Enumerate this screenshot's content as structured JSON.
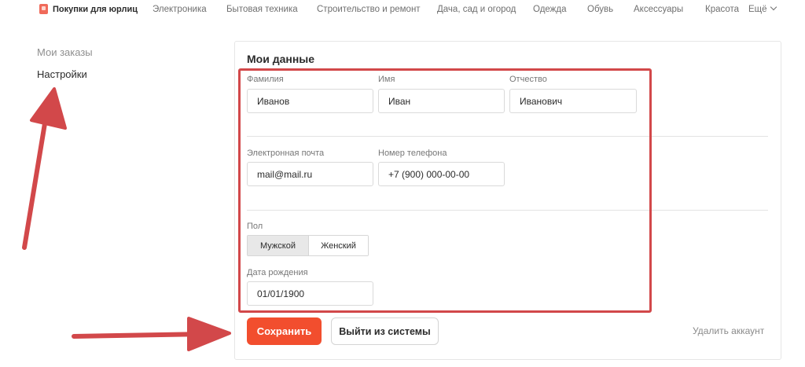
{
  "topnav": {
    "brand": "Покупки для юрлиц",
    "links": [
      "Электроника",
      "Бытовая техника",
      "Строительство и ремонт",
      "Дача, сад и огород",
      "Одежда",
      "Обувь",
      "Аксессуары",
      "Красота"
    ],
    "more": "Ещё"
  },
  "sidebar": {
    "items": [
      {
        "label": "Мои заказы",
        "active": false
      },
      {
        "label": "Настройки",
        "active": true
      }
    ]
  },
  "profile": {
    "title": "Мои данные",
    "last_name": {
      "label": "Фамилия",
      "value": "Иванов"
    },
    "first_name": {
      "label": "Имя",
      "value": "Иван"
    },
    "middle_name": {
      "label": "Отчество",
      "value": "Иванович"
    },
    "email": {
      "label": "Электронная почта",
      "value": "mail@mail.ru"
    },
    "phone": {
      "label": "Номер телефона",
      "value": "+7 (900) 000-00-00"
    },
    "gender": {
      "label": "Пол",
      "options": [
        "Мужской",
        "Женский"
      ],
      "selected": "Мужской"
    },
    "birthdate": {
      "label": "Дата рождения",
      "value": "01/01/1900"
    }
  },
  "actions": {
    "save": "Сохранить",
    "logout": "Выйти из системы",
    "delete": "Удалить аккаунт"
  },
  "colors": {
    "accent": "#f24e2e",
    "annotation": "#d2484a",
    "muted_text": "#8a8a8a"
  }
}
